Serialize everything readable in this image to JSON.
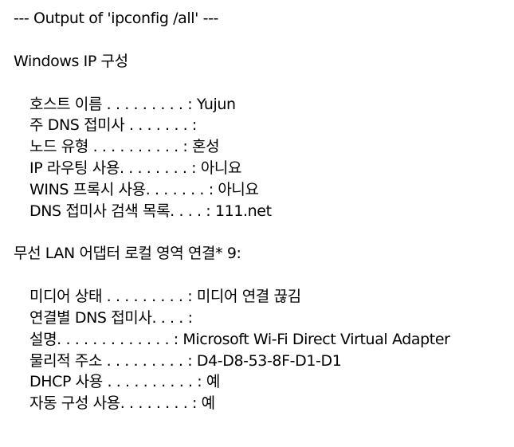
{
  "header": "--- Output of 'ipconfig /all' ---",
  "section1": {
    "title": "Windows IP 구성",
    "rows": [
      "호스트 이름 . . . . . . . . . : Yujun",
      "주 DNS 접미사 . . . . . . . :",
      "노드 유형 . . . . . . . . . . : 혼성",
      "IP 라우팅 사용. . . . . . . . : 아니요",
      "WINS 프록시 사용. . . . . . . : 아니요",
      "DNS 접미사 검색 목록. . . . : 111.net"
    ]
  },
  "section2": {
    "title": "무선 LAN 어댑터 로컬 영역 연결* 9:",
    "rows": [
      "미디어 상태 . . . . . . . . . : 미디어 연결 끊김",
      "연결별 DNS 접미사. . . . :",
      "설명. . . . . . . . . . . . . : Microsoft Wi-Fi Direct Virtual Adapter",
      "물리적 주소 . . . . . . . . . : D4-D8-53-8F-D1-D1",
      "DHCP 사용 . . . . . . . . . . : 예",
      "자동 구성 사용. . . . . . . . : 예"
    ]
  }
}
